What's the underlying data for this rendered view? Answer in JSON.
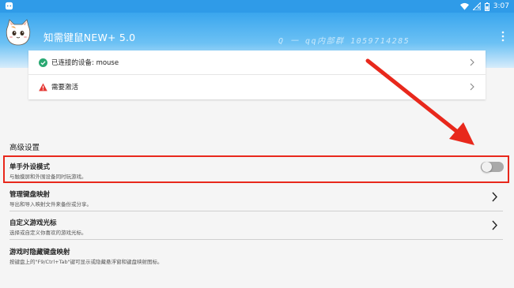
{
  "statusbar": {
    "time": "3:07",
    "icons": [
      "android-notification-icon",
      "wifi-icon",
      "no-signal-icon",
      "battery-icon"
    ]
  },
  "appbar": {
    "title": "知需键鼠NEW+ 5.0",
    "watermark": "Q 一 qq内部群 1059714285",
    "more_icon": "more-vertical-icon",
    "color": "#3aa6ee"
  },
  "connection_card": {
    "device": {
      "label": "已连接的设备: mouse",
      "icon": "check-circle-icon",
      "color": "#2aa872"
    },
    "activation": {
      "label": "需要激活",
      "icon": "warning-icon",
      "color": "#e53935"
    }
  },
  "advanced": {
    "title": "高级设置",
    "items": [
      {
        "title": "单手外设模式",
        "desc": "与触摸屏和外围设备同时玩游戏。",
        "control": "toggle",
        "enabled": false
      },
      {
        "title": "管理键盘映射",
        "desc": "导出和导入映射文件来备份或分享。",
        "control": "chevron"
      },
      {
        "title": "自定义游戏光标",
        "desc": "选择或自定义你喜欢的游戏光标。",
        "control": "chevron"
      },
      {
        "title": "游戏时隐藏键盘映射",
        "desc": "按键盘上的\"F9/Ctrl+Tab\"键可显示或隐藏悬浮窗和键盘映射图标。",
        "control": "none"
      }
    ]
  },
  "annotation": {
    "color": "#e8281c"
  }
}
